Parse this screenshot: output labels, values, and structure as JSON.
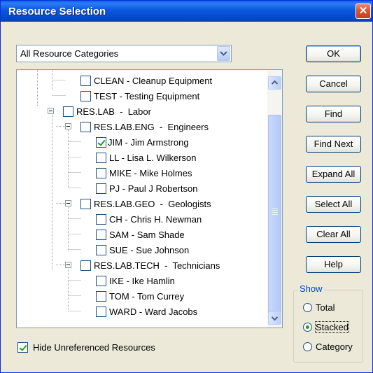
{
  "window": {
    "title": "Resource Selection",
    "close_glyph": "✕"
  },
  "category_combo": {
    "value": "All Resource Categories"
  },
  "tree": {
    "items": [
      {
        "label": "CLEAN - Cleanup Equipment",
        "checked": false,
        "level": 3
      },
      {
        "label": "TEST - Testing Equipment",
        "checked": false,
        "level": 3
      },
      {
        "label": "RES.LAB  -  Labor",
        "checked": false,
        "level": 1,
        "expanded": true
      },
      {
        "label": "RES.LAB.ENG  -  Engineers",
        "checked": false,
        "level": 2,
        "expanded": true
      },
      {
        "label": "JIM - Jim Armstrong",
        "checked": true,
        "level": 3
      },
      {
        "label": "LL - Lisa L. Wilkerson",
        "checked": false,
        "level": 3
      },
      {
        "label": "MIKE - Mike Holmes",
        "checked": false,
        "level": 3
      },
      {
        "label": "PJ - Paul J Robertson",
        "checked": false,
        "level": 3
      },
      {
        "label": "RES.LAB.GEO  -  Geologists",
        "checked": false,
        "level": 2,
        "expanded": true
      },
      {
        "label": "CH - Chris H. Newman",
        "checked": false,
        "level": 3
      },
      {
        "label": "SAM - Sam Shade",
        "checked": false,
        "level": 3
      },
      {
        "label": "SUE - Sue Johnson",
        "checked": false,
        "level": 3
      },
      {
        "label": "RES.LAB.TECH  -  Technicians",
        "checked": false,
        "level": 2,
        "expanded": true
      },
      {
        "label": "IKE - Ike Hamlin",
        "checked": false,
        "level": 3
      },
      {
        "label": "TOM - Tom Currey",
        "checked": false,
        "level": 3
      },
      {
        "label": "WARD - Ward Jacobs",
        "checked": false,
        "level": 3
      }
    ]
  },
  "hide_unreferenced": {
    "label": "Hide Unreferenced Resources",
    "checked": true
  },
  "buttons": {
    "ok": "OK",
    "cancel": "Cancel",
    "find": "Find",
    "find_next": "Find Next",
    "expand_all": "Expand All",
    "select_all": "Select All",
    "clear_all": "Clear All",
    "help": "Help"
  },
  "show_group": {
    "title": "Show",
    "options": [
      {
        "label": "Total",
        "selected": false
      },
      {
        "label": "Stacked",
        "selected": true
      },
      {
        "label": "Category",
        "selected": false
      }
    ]
  },
  "colors": {
    "title_bar": "#0a58dc",
    "dialog_bg": "#ece9d8",
    "check_green": "#21a121",
    "group_title": "#0046d5"
  }
}
